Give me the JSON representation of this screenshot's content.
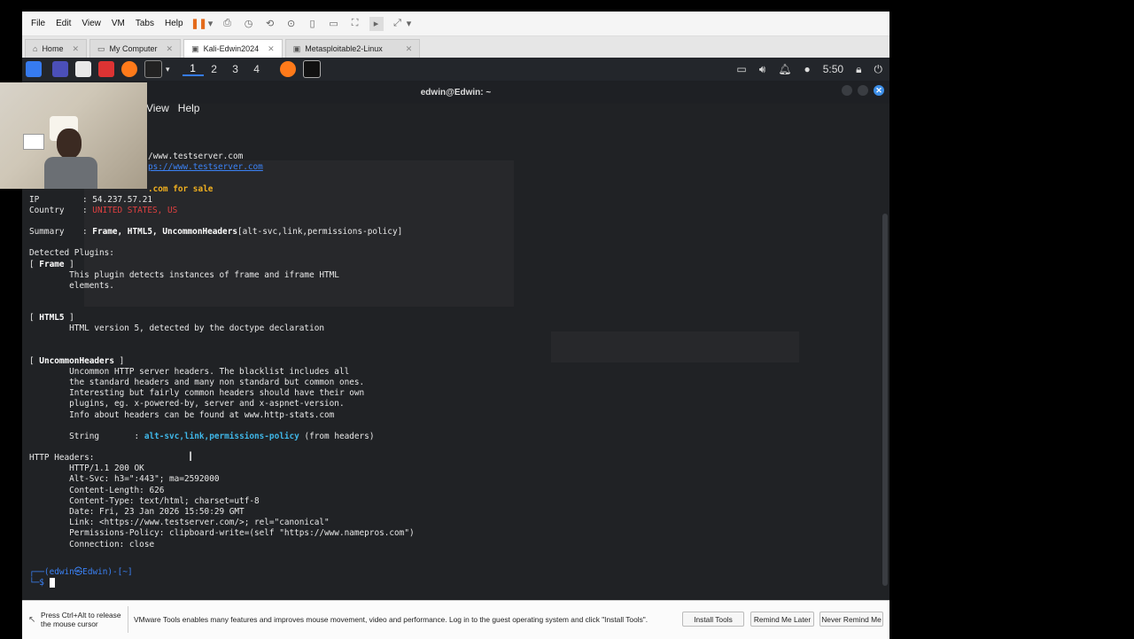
{
  "menu": {
    "file": "File",
    "edit": "Edit",
    "view": "View",
    "vm": "VM",
    "tabs": "Tabs",
    "help": "Help"
  },
  "tabs": [
    {
      "label": "Home",
      "icon": "home-icon"
    },
    {
      "label": "My Computer",
      "icon": "computer-icon"
    },
    {
      "label": "Kali-Edwin2024",
      "icon": "vm-icon"
    },
    {
      "label": "Metasploitable2-Linux",
      "icon": "vm-icon"
    }
  ],
  "panel": {
    "workspaces": [
      "1",
      "2",
      "3",
      "4"
    ],
    "time": "5:50"
  },
  "terminal": {
    "title": "edwin@Edwin: ~",
    "menu_view": "View",
    "menu_help": "Help",
    "lines": {
      "l1": "/www.testserver.com",
      "l2": "ps://www.testserver.com",
      "l3": ".com for sale",
      "ip_label": "IP",
      "ip_value": ": 54.237.57.21",
      "country_label": "Country",
      "country_sep": ": ",
      "country_value": "UNITED STATES, US",
      "summary_label": "Summary",
      "summary_sep": ": ",
      "summary_value_bold": "Frame, HTML5, UncommonHeaders",
      "summary_value_rest": "[alt-svc,link,permissions-policy]",
      "detected": "Detected Plugins:",
      "frame_open": "[ ",
      "frame_name": "Frame",
      "frame_close": " ]",
      "frame_d1": "        This plugin detects instances of frame and iframe HTML",
      "frame_d2": "        elements.",
      "html5_name": "HTML5",
      "html5_d1": "        HTML version 5, detected by the doctype declaration",
      "uh_name": "UncommonHeaders",
      "uh_d1": "        Uncommon HTTP server headers. The blacklist includes all",
      "uh_d2": "        the standard headers and many non standard but common ones.",
      "uh_d3": "        Interesting but fairly common headers should have their own",
      "uh_d4": "        plugins, eg. x-powered-by, server and x-aspnet-version.",
      "uh_d5": "        Info about headers can be found at www.http-stats.com",
      "string_label": "        String       : ",
      "string_value": "alt-svc,link,permissions-policy",
      "string_from": " (from headers)",
      "http_headers": "HTTP Headers:",
      "h1": "        HTTP/1.1 200 OK",
      "h2": "        Alt-Svc: h3=\":443\"; ma=2592000",
      "h3": "        Content-Length: 626",
      "h4": "        Content-Type: text/html; charset=utf-8",
      "h5": "        Date: Fri, 23 Jan 2026 15:50:29 GMT",
      "h6": "        Link: <https://www.testserver.com/>; rel=\"canonical\"",
      "h7": "        Permissions-Policy: clipboard-write=(self \"https://www.namepros.com\")",
      "h8": "        Connection: close"
    },
    "prompt_line1": "┌──(edwin㉿Edwin)-[~]",
    "prompt_line2": "└─$ "
  },
  "hint": {
    "release": "Press Ctrl+Alt to release the mouse cursor",
    "message": "VMware Tools enables many features and improves mouse movement, video and performance. Log in to the guest operating system and click \"Install Tools\".",
    "install": "Install Tools",
    "remind": "Remind Me Later",
    "never": "Never Remind Me"
  },
  "colors": {
    "accent": "#367bf0",
    "error_red": "#e04040",
    "cyan": "#3fb7e8",
    "orange": "#f0b020"
  }
}
